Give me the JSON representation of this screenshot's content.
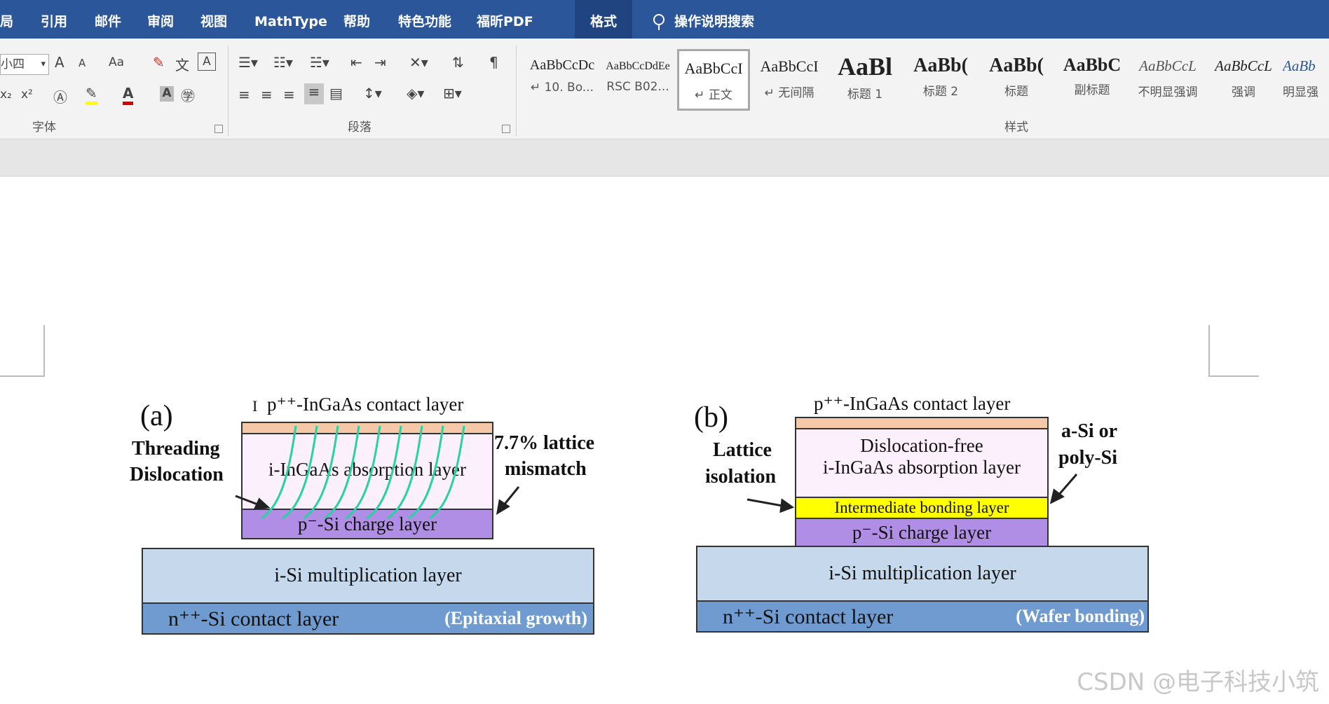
{
  "menu": {
    "items": [
      "局",
      "引用",
      "邮件",
      "审阅",
      "视图",
      "MathType",
      "帮助",
      "特色功能",
      "福昕PDF",
      "格式"
    ],
    "search_label": "操作说明搜索"
  },
  "ribbon": {
    "font_size": "小四",
    "grow_font": "A",
    "shrink_font": "A",
    "change_case": "Aa",
    "subscript": "x₂",
    "superscript": "x²",
    "font_color_letter": "A",
    "char_shading_letter": "A",
    "font_group": "字体",
    "paragraph_group": "段落",
    "styles_group": "样式",
    "styles": [
      {
        "preview": "AaBbCcDc",
        "name": "↵ 10. Bo..."
      },
      {
        "preview": "AaBbCcDdEe",
        "name": "RSC B02..."
      },
      {
        "preview": "AaBbCcI",
        "name": "↵ 正文"
      },
      {
        "preview": "AaBbCcI",
        "name": "↵ 无间隔"
      },
      {
        "preview": "AaBl",
        "name": "标题 1"
      },
      {
        "preview": "AaBb(",
        "name": "标题 2"
      },
      {
        "preview": "AaBb(",
        "name": "标题"
      },
      {
        "preview": "AaBbC",
        "name": "副标题"
      },
      {
        "preview": "AaBbCcL",
        "name": "不明显强调"
      },
      {
        "preview": "AaBbCcL",
        "name": "强调"
      },
      {
        "preview": "AaBb",
        "name": "明显强"
      }
    ]
  },
  "figure_a": {
    "tag": "(a)",
    "contact_top": "p⁺⁺-InGaAs contact layer",
    "left_note": [
      "Threading",
      "Dislocation"
    ],
    "right_note": [
      "7.7% lattice",
      "mismatch"
    ],
    "absorption": "i-InGaAs absorption layer",
    "charge": "p⁻-Si charge layer",
    "multiplication": "i-Si multiplication layer",
    "contact_bottom": "n⁺⁺-Si contact layer",
    "method": "(Epitaxial growth)"
  },
  "figure_b": {
    "tag": "(b)",
    "contact_top": "p⁺⁺-InGaAs contact layer",
    "left_note": [
      "Lattice",
      "isolation"
    ],
    "right_note": [
      "a-Si or",
      "poly-Si"
    ],
    "absorption": [
      "Dislocation-free",
      "i-InGaAs absorption layer"
    ],
    "bonding": "Intermediate bonding layer",
    "charge": "p⁻-Si charge layer",
    "multiplication": "i-Si multiplication layer",
    "contact_bottom": "n⁺⁺-Si contact layer",
    "method": "(Wafer bonding)"
  },
  "watermark": "CSDN @电子科技小筑",
  "colors": {
    "menubar": "#2b579a",
    "contact_top": "#f5c9a8",
    "absorption": "#fbf0fb",
    "charge": "#b08ee6",
    "multiplication": "#c5d8ec",
    "contact_bottom": "#6f9bd1",
    "bonding": "#ffff00",
    "dislocation": "#27d3a0"
  }
}
